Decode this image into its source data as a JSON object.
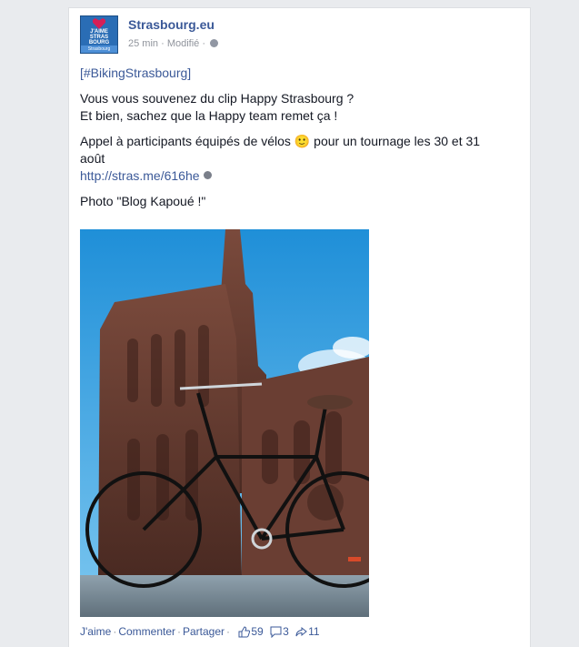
{
  "post": {
    "page_name": "Strasbourg.eu",
    "time": "25 min",
    "edited": "Modifié",
    "separator": "·",
    "avatar": {
      "logo_text_1": "J'AIME",
      "logo_text_2": "STRAS",
      "logo_text_3": "BOURG",
      "bottom_text": "Strasbourg"
    },
    "hashtag": "[#BikingStrasbourg]",
    "line1": "Vous vous souvenez du clip Happy Strasbourg ?",
    "line2": "Et bien, sachez que la Happy team remet ça !",
    "line3a": "Appel à participants équipés de vélos",
    "emoji": "🙂",
    "line3b": "pour un tournage les 30 et 31",
    "line4": "août",
    "link": "http://stras.me/616he",
    "credit": "Photo \"Blog Kapoué !\""
  },
  "actions": {
    "like": "J'aime",
    "comment": "Commenter",
    "share": "Partager",
    "likes_count": "59",
    "comments_count": "3",
    "shares_count": "11"
  },
  "colors": {
    "link": "#3b5998",
    "background": "#e9ebee",
    "card": "#ffffff"
  }
}
